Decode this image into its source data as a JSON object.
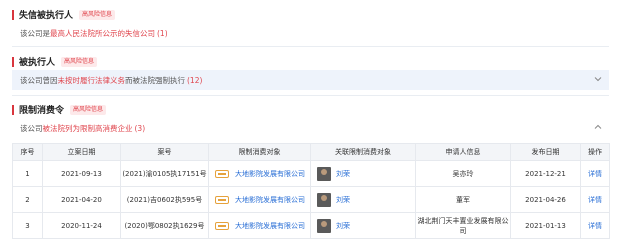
{
  "sections": {
    "dishonest": {
      "title": "失信被执行人",
      "badge": "高风险信息",
      "text_pre": "该公司是",
      "text_hl": "最高人民法院所公示的失信公司",
      "text_count": "(1)"
    },
    "executed": {
      "title": "被执行人",
      "badge": "高风险信息",
      "text_pre": "该公司曾因",
      "text_hl": "未按时履行法律义务",
      "text_post": "而被法院强制执行",
      "text_count": "(12)"
    },
    "restriction": {
      "title": "限制消费令",
      "badge": "高风险信息",
      "text_pre": "该公司",
      "text_hl": "被法院列为限制高消费企业",
      "text_count": "(3)"
    }
  },
  "table": {
    "headers": [
      "序号",
      "立案日期",
      "案号",
      "限制消费对象",
      "关联限制消费对象",
      "申请人信息",
      "发布日期",
      "操作"
    ],
    "rows": [
      {
        "idx": "1",
        "date": "2021-09-13",
        "case": "(2021)渝0105执17151号",
        "target": "大地影院发展有限公司",
        "related": "刘荣",
        "applicant": "吴亦玲",
        "pub": "2021-12-21",
        "action": "详情"
      },
      {
        "idx": "2",
        "date": "2021-04-20",
        "case": "(2021)吉0602执595号",
        "target": "大地影院发展有限公司",
        "related": "刘荣",
        "applicant": "董军",
        "pub": "2021-04-26",
        "action": "详情"
      },
      {
        "idx": "3",
        "date": "2020-11-24",
        "case": "(2020)鄂0802执1629号",
        "target": "大地影院发展有限公司",
        "related": "刘荣",
        "applicant": "湖北荆门天丰置业发展有限公司",
        "pub": "2021-01-13",
        "action": "详情"
      }
    ]
  },
  "icons": {
    "chevron_down": "chevron-down-icon",
    "chevron_up": "chevron-up-icon"
  },
  "colors": {
    "accent_red": "#e0454d",
    "link_blue": "#2a6fd6",
    "shade": "#eef3fb"
  }
}
